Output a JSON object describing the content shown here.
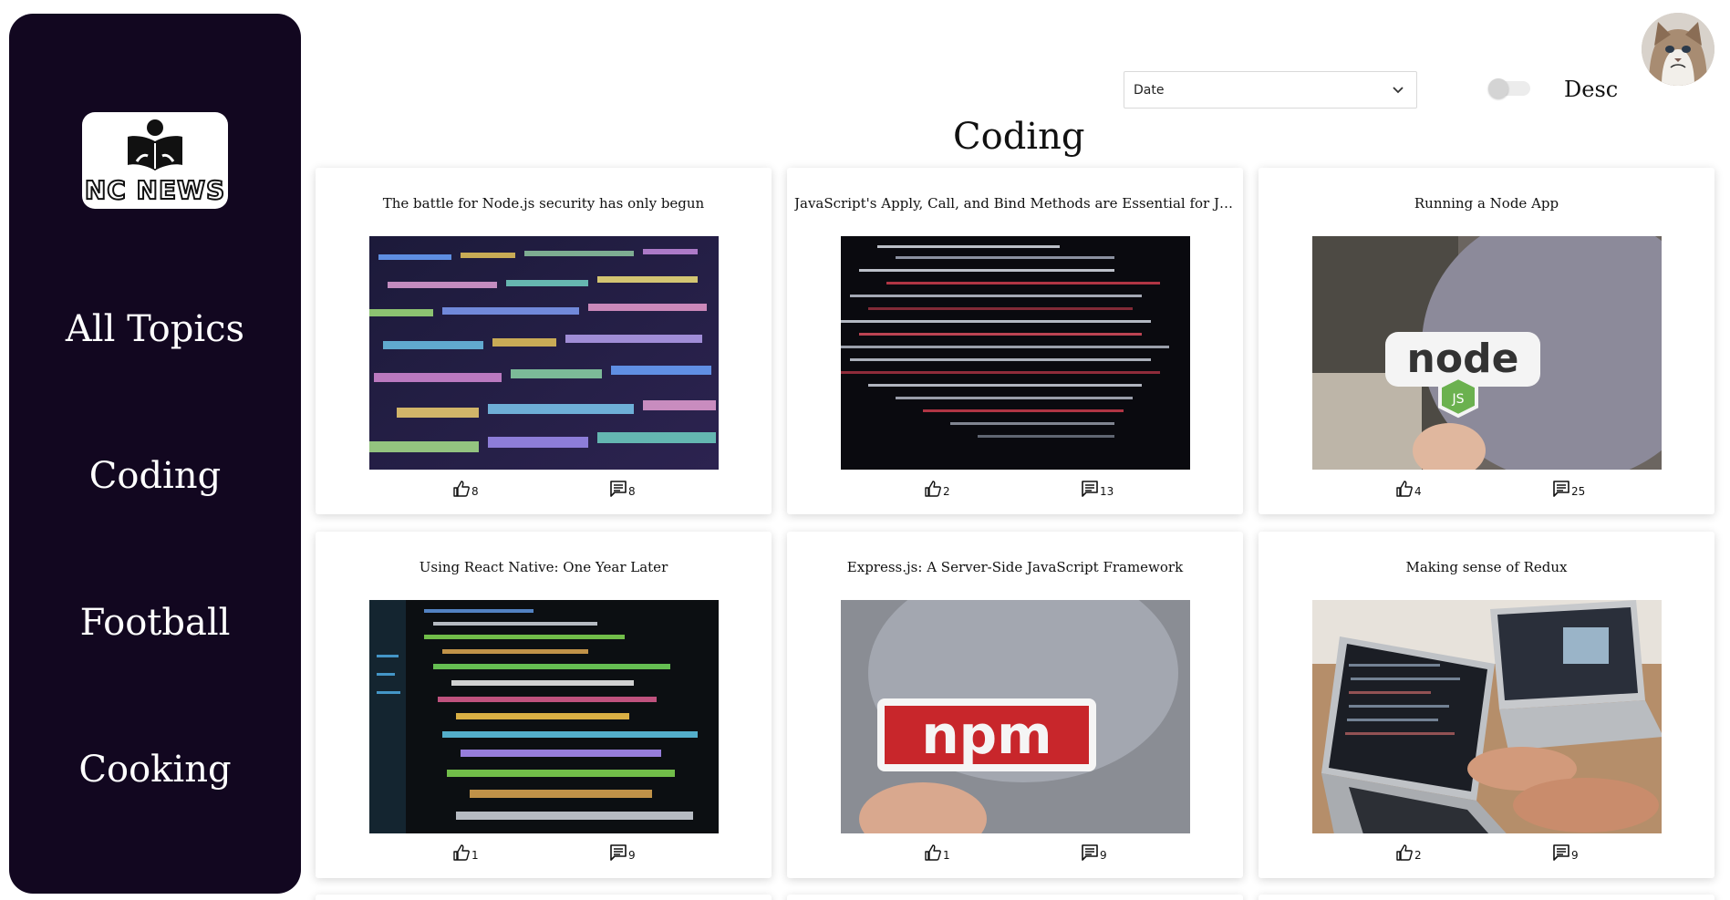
{
  "sidebar": {
    "logo_text": "NC NEWS",
    "items": [
      {
        "label": "All Topics"
      },
      {
        "label": "Coding"
      },
      {
        "label": "Football"
      },
      {
        "label": "Cooking"
      }
    ]
  },
  "controls": {
    "sort_value": "Date",
    "order_label": "Desc",
    "order_toggle_on": false
  },
  "page": {
    "title": "Coding"
  },
  "icons": {
    "vote": "thumbs-up-icon",
    "comment": "comment-icon",
    "chevron": "chevron-down-icon"
  },
  "articles": [
    {
      "title": "The battle for Node.js security has only begun",
      "votes": "8",
      "comments": "8"
    },
    {
      "title": "JavaScript's Apply, Call, and Bind Methods are Essential for Java...",
      "votes": "2",
      "comments": "13"
    },
    {
      "title": "Running a Node App",
      "votes": "4",
      "comments": "25"
    },
    {
      "title": "Using React Native: One Year Later",
      "votes": "1",
      "comments": "9"
    },
    {
      "title": "Express.js: A Server-Side JavaScript Framework",
      "votes": "1",
      "comments": "9"
    },
    {
      "title": "Making sense of Redux",
      "votes": "2",
      "comments": "9"
    }
  ]
}
